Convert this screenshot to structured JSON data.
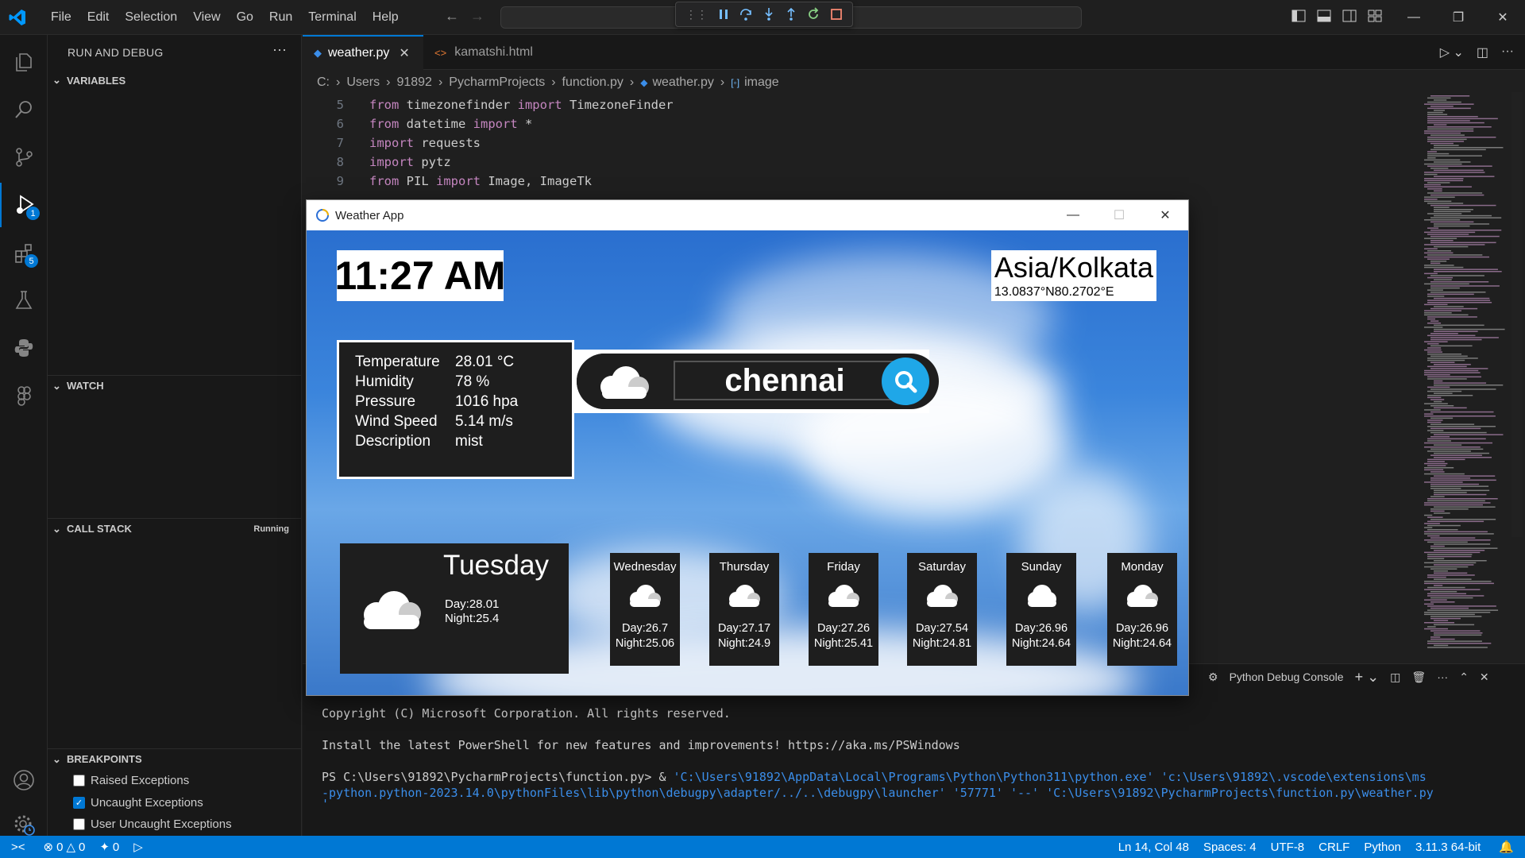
{
  "menu": [
    "File",
    "Edit",
    "Selection",
    "View",
    "Go",
    "Run",
    "Terminal",
    "Help"
  ],
  "activity": {
    "debug_badge": "1",
    "extensions_badge": "5"
  },
  "sidebar": {
    "title": "RUN AND DEBUG",
    "sections": {
      "variables": "VARIABLES",
      "watch": "WATCH",
      "callstack": "CALL STACK",
      "callstack_status": "Running",
      "breakpoints": "BREAKPOINTS"
    },
    "breakpoints": [
      {
        "label": "Raised Exceptions",
        "checked": false
      },
      {
        "label": "Uncaught Exceptions",
        "checked": true
      },
      {
        "label": "User Uncaught Exceptions",
        "checked": false
      }
    ]
  },
  "tabs": [
    {
      "label": "weather.py",
      "active": true
    },
    {
      "label": "kamatshi.html",
      "active": false
    }
  ],
  "breadcrumb": [
    "C:",
    "Users",
    "91892",
    "PycharmProjects",
    "function.py",
    "weather.py",
    "image"
  ],
  "code": [
    {
      "n": "5",
      "tokens": [
        [
          "kw",
          "from"
        ],
        [
          "t",
          " timezonefinder "
        ],
        [
          "kw",
          "import"
        ],
        [
          "t",
          " TimezoneFinder"
        ]
      ]
    },
    {
      "n": "6",
      "tokens": [
        [
          "kw",
          "from"
        ],
        [
          "t",
          " datetime "
        ],
        [
          "kw",
          "import"
        ],
        [
          "t",
          " *"
        ]
      ]
    },
    {
      "n": "7",
      "tokens": [
        [
          "kw",
          "import"
        ],
        [
          "t",
          " requests"
        ]
      ]
    },
    {
      "n": "8",
      "tokens": [
        [
          "kw",
          "import"
        ],
        [
          "t",
          " pytz"
        ]
      ]
    },
    {
      "n": "9",
      "tokens": [
        [
          "kw",
          "from"
        ],
        [
          "t",
          " PIL "
        ],
        [
          "kw",
          "import"
        ],
        [
          "t",
          " Image, ImageTk"
        ]
      ]
    }
  ],
  "weather_app": {
    "window_title": "Weather App",
    "time": "11:27 AM",
    "timezone": "Asia/Kolkata",
    "coords": "13.0837°N80.2702°E",
    "info": [
      {
        "k": "Temperature",
        "v": "28.01 °C"
      },
      {
        "k": "Humidity",
        "v": "78 %"
      },
      {
        "k": "Pressure",
        "v": "1016 hpa"
      },
      {
        "k": "Wind Speed",
        "v": "5.14 m/s"
      },
      {
        "k": "Description",
        "v": "mist"
      }
    ],
    "search_value": "chennai",
    "today": {
      "day": "Tuesday",
      "dayt": "Day:28.01",
      "night": "Night:25.4"
    },
    "forecast": [
      {
        "day": "Wednesday",
        "dayt": "Day:26.7",
        "night": "Night:25.06"
      },
      {
        "day": "Thursday",
        "dayt": "Day:27.17",
        "night": "Night:24.9"
      },
      {
        "day": "Friday",
        "dayt": "Day:27.26",
        "night": "Night:25.41"
      },
      {
        "day": "Saturday",
        "dayt": "Day:27.54",
        "night": "Night:24.81"
      },
      {
        "day": "Sunday",
        "dayt": "Day:26.96",
        "night": "Night:24.64"
      },
      {
        "day": "Monday",
        "dayt": "Day:26.96",
        "night": "Night:24.64"
      }
    ]
  },
  "panel": {
    "title": "Python Debug Console",
    "lines": [
      "Copyright (C) Microsoft Corporation. All rights reserved.",
      "Install the latest PowerShell for new features and improvements! https://aka.ms/PSWindows"
    ],
    "prompt": "PS C:\\Users\\91892\\PycharmProjects\\function.py>  & ",
    "cmd1": "'C:\\Users\\91892\\AppData\\Local\\Programs\\Python\\Python311\\python.exe' 'c:\\Users\\91892\\.vscode\\extensions\\ms",
    "cmd2": "-python.python-2023.14.0\\pythonFiles\\lib\\python\\debugpy\\adapter/../..\\debugpy\\launcher' '57771' '--' 'C:\\Users\\91892\\PycharmProjects\\function.py\\weather.py",
    "cmd3": "'"
  },
  "status": {
    "errors": "0",
    "warnings": "0",
    "ports": "0",
    "position": "Ln 14, Col 48",
    "spaces": "Spaces: 4",
    "encoding": "UTF-8",
    "eol": "CRLF",
    "language": "Python",
    "interpreter": "3.11.3 64-bit"
  }
}
